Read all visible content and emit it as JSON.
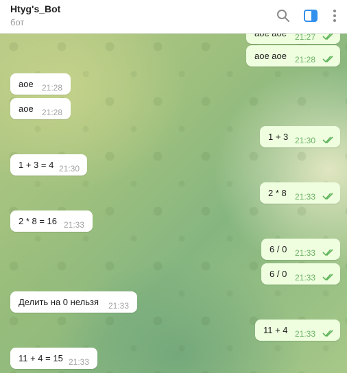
{
  "header": {
    "title": "Htyg's_Bot",
    "subtitle": "бот"
  },
  "messages": [
    {
      "dir": "out",
      "text": "aoe aoe",
      "time": "21:27",
      "read": true
    },
    {
      "dir": "out",
      "text": "aoe aoe",
      "time": "21:28",
      "read": true
    },
    {
      "dir": "in",
      "text": "aoe",
      "time": "21:28"
    },
    {
      "dir": "in",
      "text": "aoe",
      "time": "21:28"
    },
    {
      "dir": "out",
      "text": "1 + 3",
      "time": "21:30",
      "read": true
    },
    {
      "dir": "in",
      "text": "1 + 3 = 4",
      "time": "21:30"
    },
    {
      "dir": "out",
      "text": "2 * 8",
      "time": "21:33",
      "read": true
    },
    {
      "dir": "in",
      "text": "2 * 8 = 16",
      "time": "21:33"
    },
    {
      "dir": "out",
      "text": "6 / 0",
      "time": "21:33",
      "read": true
    },
    {
      "dir": "out",
      "text": "6 / 0",
      "time": "21:33",
      "read": true
    },
    {
      "dir": "in",
      "text": "Делить на 0 нельзя",
      "time": "21:33"
    },
    {
      "dir": "out",
      "text": "11 + 4",
      "time": "21:33",
      "read": true
    },
    {
      "dir": "in",
      "text": "11 + 4 = 15",
      "time": "21:33"
    }
  ],
  "colors": {
    "incoming_bubble": "#ffffff",
    "outgoing_bubble": "#eefedf",
    "accent": "#3390ec",
    "read_check": "#5fb35a"
  },
  "icons": {
    "search": "search-icon",
    "sidebar": "sidebar-toggle-icon",
    "menu": "more-vertical-icon",
    "check": "double-check-icon"
  }
}
